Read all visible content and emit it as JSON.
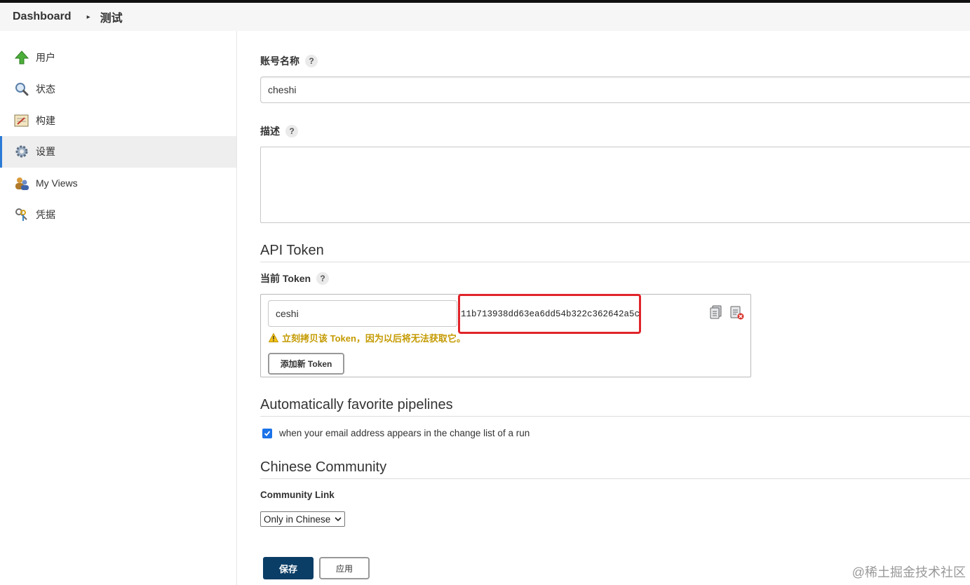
{
  "breadcrumb": {
    "home": "Dashboard",
    "separator": "▸",
    "current": "测试"
  },
  "sidebar": {
    "items": [
      {
        "label": "用户",
        "icon": "up-arrow-icon"
      },
      {
        "label": "状态",
        "icon": "magnifier-icon"
      },
      {
        "label": "构建",
        "icon": "notepad-icon"
      },
      {
        "label": "设置",
        "icon": "gear-icon"
      },
      {
        "label": "My Views",
        "icon": "people-icon"
      },
      {
        "label": "凭据",
        "icon": "keys-icon"
      }
    ],
    "active_index": 3,
    "accent_color": "#2b7bd6"
  },
  "form": {
    "account_label": "账号名称",
    "account_value": "cheshi",
    "description_label": "描述",
    "description_value": "",
    "help_symbol": "?"
  },
  "api_token": {
    "section_title": "API Token",
    "current_label": "当前 Token",
    "token_name": "ceshi",
    "token_value": "11b713938dd63ea6dd54b322c362642a5c",
    "warning": "立刻拷贝该 Token，因为以后将无法获取它。",
    "add_button": "添加新 Token",
    "highlight_color": "#e0242a"
  },
  "favorites": {
    "section_title": "Automatically favorite pipelines",
    "checkbox_label": "when your email address appears in the change list of a run",
    "checked": true
  },
  "community": {
    "section_title": "Chinese Community",
    "link_label": "Community Link",
    "selected_option": "Only in Chinese"
  },
  "actions": {
    "save": "保存",
    "apply": "应用"
  },
  "watermark": "@稀土掘金技术社区"
}
